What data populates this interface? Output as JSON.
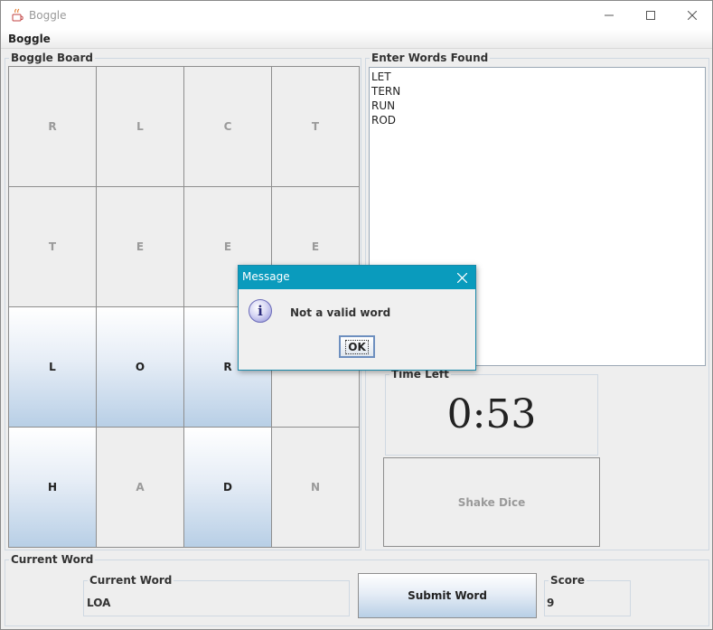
{
  "window": {
    "title": "Boggle"
  },
  "menu": {
    "boggle_label": "Boggle"
  },
  "board": {
    "title": "Boggle Board",
    "cells": [
      {
        "letter": "R",
        "selected": false
      },
      {
        "letter": "L",
        "selected": false
      },
      {
        "letter": "C",
        "selected": false
      },
      {
        "letter": "T",
        "selected": false
      },
      {
        "letter": "T",
        "selected": false
      },
      {
        "letter": "E",
        "selected": false
      },
      {
        "letter": "E",
        "selected": false
      },
      {
        "letter": "E",
        "selected": false
      },
      {
        "letter": "L",
        "selected": true
      },
      {
        "letter": "O",
        "selected": true
      },
      {
        "letter": "R",
        "selected": true
      },
      {
        "letter": "",
        "selected": false
      },
      {
        "letter": "H",
        "selected": true
      },
      {
        "letter": "A",
        "selected": false
      },
      {
        "letter": "D",
        "selected": true
      },
      {
        "letter": "N",
        "selected": false
      }
    ]
  },
  "words": {
    "title": "Enter Words Found",
    "list": [
      "LET",
      "TERN",
      "RUN",
      "ROD"
    ]
  },
  "timer": {
    "title": "Time Left",
    "value": "0:53"
  },
  "shake": {
    "label": "Shake Dice"
  },
  "current": {
    "section_title": "Current Word",
    "field_title": "Current Word",
    "value": "LOA",
    "submit_label": "Submit Word"
  },
  "score": {
    "title": "Score",
    "value": "9"
  },
  "dialog": {
    "title": "Message",
    "message": "Not a valid word",
    "ok_label": "OK"
  },
  "colors": {
    "dialog_titlebar": "#0a9bbd",
    "selected_tile_bottom": "#b8cfe6"
  }
}
